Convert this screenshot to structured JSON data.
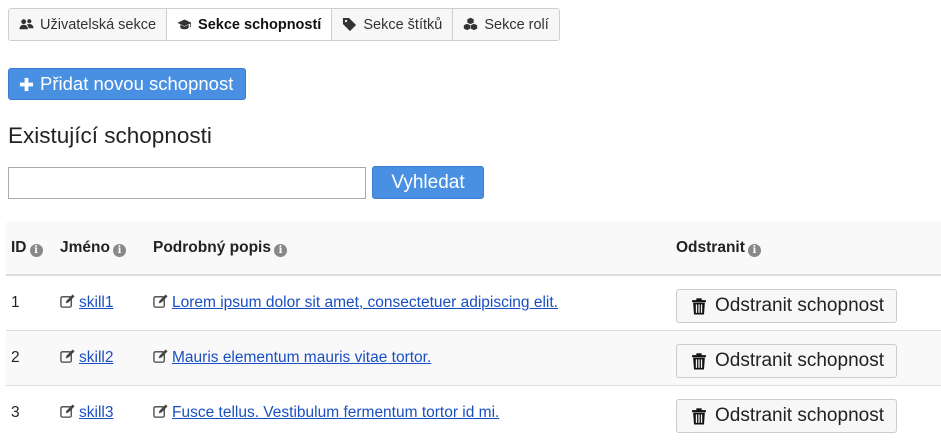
{
  "tabs": [
    {
      "label": "Uživatelská sekce",
      "icon": "users-icon",
      "active": false
    },
    {
      "label": "Sekce schopností",
      "icon": "graduation-cap-icon",
      "active": true
    },
    {
      "label": "Sekce štítků",
      "icon": "tag-icon",
      "active": false
    },
    {
      "label": "Sekce rolí",
      "icon": "cubes-icon",
      "active": false
    }
  ],
  "add_button": {
    "label": "Přidat novou schopnost",
    "icon": "plus-icon"
  },
  "section_title": "Existující schopnosti",
  "search": {
    "value": "",
    "placeholder": "",
    "button_label": "Vyhledat"
  },
  "table": {
    "columns": [
      "ID",
      "Jméno",
      "Podrobný popis",
      "Odstranit"
    ],
    "rows": [
      {
        "id": "1",
        "name": "skill1",
        "description": "Lorem ipsum dolor sit amet, consectetuer adipiscing elit.",
        "delete_label": "Odstranit schopnost"
      },
      {
        "id": "2",
        "name": "skill2",
        "description": "Mauris elementum mauris vitae tortor.",
        "delete_label": "Odstranit schopnost"
      },
      {
        "id": "3",
        "name": "skill3",
        "description": "Fusce tellus. Vestibulum fermentum tortor id mi.",
        "delete_label": "Odstranit schopnost"
      }
    ]
  },
  "colors": {
    "primary": "#4a90e2",
    "link": "#1a4fc4"
  }
}
